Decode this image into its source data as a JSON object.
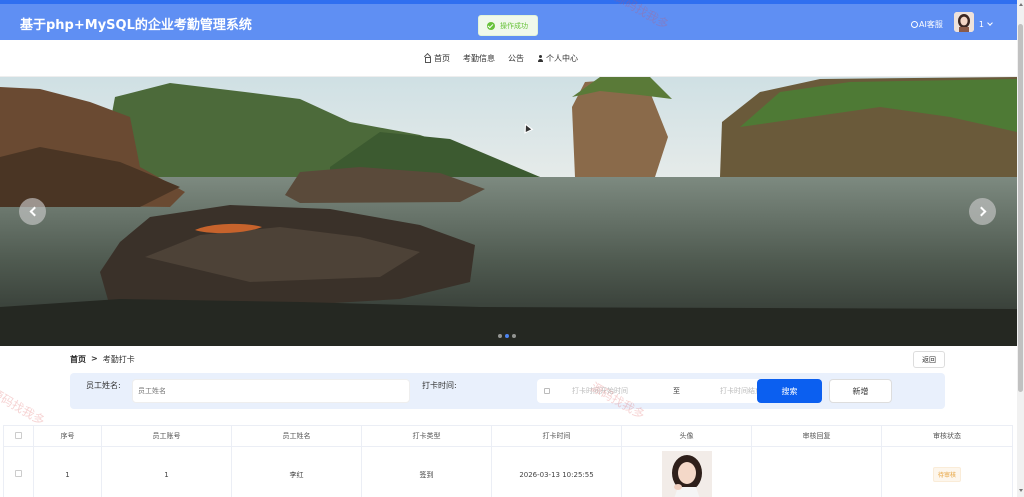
{
  "header": {
    "site_title": "基于php+MySQL的企业考勤管理系统",
    "toast_text": "操作成功",
    "ai_service_label": "AI客服",
    "user_name": "1"
  },
  "nav": {
    "items": [
      {
        "label": "首页",
        "icon": "home-icon"
      },
      {
        "label": "考勤信息"
      },
      {
        "label": "公告"
      },
      {
        "label": "个人中心",
        "icon": "person-icon"
      }
    ]
  },
  "banner": {
    "slide_count": 3,
    "active_slide": 2
  },
  "breadcrumb": {
    "home": "首页",
    "separator": ">",
    "current": "考勤打卡"
  },
  "back_button": "返回",
  "search": {
    "employee_name_label": "员工姓名:",
    "employee_name_placeholder": "员工姓名",
    "clock_time_label": "打卡时间:",
    "start_placeholder": "打卡时间开始时间",
    "range_separator": "至",
    "end_placeholder": "打卡时间结束时间",
    "search_button": "搜索",
    "add_button": "新增"
  },
  "table": {
    "columns": [
      "序号",
      "员工账号",
      "员工姓名",
      "打卡类型",
      "打卡时间",
      "头像",
      "审核回复",
      "审核状态"
    ],
    "rows": [
      {
        "index": "1",
        "account": "1",
        "name": "李红",
        "type": "签到",
        "time": "2026-03-13 10:25:55",
        "reply": "",
        "status": "待审核"
      }
    ]
  },
  "colors": {
    "header_bg": "#5f8ff3",
    "primary_button": "#0b5ff0",
    "search_bar_bg": "#e9f0fc",
    "toast_green": "#67c23a",
    "status_orange": "#e6a23c"
  },
  "watermark_text": "源码找我多"
}
